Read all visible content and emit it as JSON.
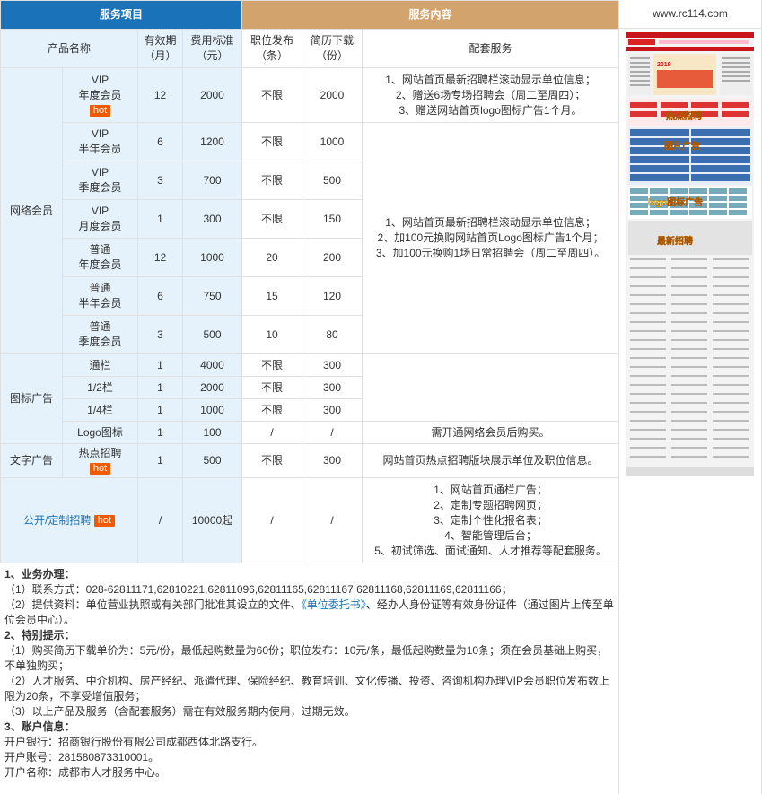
{
  "header": {
    "left": "服务项目",
    "right": "服务内容",
    "site": "www.rc114.com"
  },
  "columns": {
    "product": "产品名称",
    "period": [
      "有效期",
      "（月）"
    ],
    "fee": [
      "费用标准",
      "（元）"
    ],
    "jobs": [
      "职位发布",
      "（条）"
    ],
    "resume": [
      "简历下载",
      "（份）"
    ],
    "service": "配套服务"
  },
  "hot_label": "hot",
  "groups": {
    "network": "网络会员",
    "icon": "图标广告",
    "text": "文字广告",
    "public": "公开/定制招聘"
  },
  "rows": [
    {
      "name": [
        "VIP",
        "年度会员"
      ],
      "months": "12",
      "fee": "2000",
      "jobs": "不限",
      "resumes": "2000"
    },
    {
      "name": [
        "VIP",
        "半年会员"
      ],
      "months": "6",
      "fee": "1200",
      "jobs": "不限",
      "resumes": "1000"
    },
    {
      "name": [
        "VIP",
        "季度会员"
      ],
      "months": "3",
      "fee": "700",
      "jobs": "不限",
      "resumes": "500"
    },
    {
      "name": [
        "VIP",
        "月度会员"
      ],
      "months": "1",
      "fee": "300",
      "jobs": "不限",
      "resumes": "150"
    },
    {
      "name": [
        "普通",
        "年度会员"
      ],
      "months": "12",
      "fee": "1000",
      "jobs": "20",
      "resumes": "200"
    },
    {
      "name": [
        "普通",
        "半年会员"
      ],
      "months": "6",
      "fee": "750",
      "jobs": "15",
      "resumes": "120"
    },
    {
      "name": [
        "普通",
        "季度会员"
      ],
      "months": "3",
      "fee": "500",
      "jobs": "10",
      "resumes": "80"
    },
    {
      "name": [
        "通栏"
      ],
      "months": "1",
      "fee": "4000",
      "jobs": "不限",
      "resumes": "300"
    },
    {
      "name": [
        "1/2栏"
      ],
      "months": "1",
      "fee": "2000",
      "jobs": "不限",
      "resumes": "300"
    },
    {
      "name": [
        "1/4栏"
      ],
      "months": "1",
      "fee": "1000",
      "jobs": "不限",
      "resumes": "300"
    },
    {
      "name": [
        "Logo图标"
      ],
      "months": "1",
      "fee": "100",
      "jobs": "/",
      "resumes": "/"
    },
    {
      "name": [
        "热点招聘"
      ],
      "months": "1",
      "fee": "500",
      "jobs": "不限",
      "resumes": "300"
    },
    {
      "name": [
        ""
      ],
      "months": "/",
      "fee": "10000起",
      "jobs": "/",
      "resumes": "/"
    }
  ],
  "services": {
    "vip_year": [
      "1、网站首页最新招聘栏滚动显示单位信息；",
      "2、赠送6场专场招聘会（周二至周四）；",
      "3、赠送网站首页logo图标广告1个月。"
    ],
    "others": [
      "1、网站首页最新招聘栏滚动显示单位信息；",
      "2、加100元换购网站首页Logo图标广告1个月；",
      "3、加100元换购1场日常招聘会（周二至周四）。"
    ],
    "logo": "需开通网络会员后购买。",
    "hot": "网站首页热点招聘版块展示单位及职位信息。",
    "public": [
      "1、网站首页通栏广告；",
      "2、定制专题招聘网页；",
      "3、定制个性化报名表；",
      "4、智能管理后台；",
      "5、初试筛选、面试通知、人才推荐等配套服务。"
    ]
  },
  "notes": {
    "h1": "1、业务办理：",
    "contact": "（1）联系方式：028-62811171,62810221,62811096,62811165,62811167,62811168,62811169,62811166；",
    "materials_a": "（2）提供资料：单位营业执照或有关部门批准其设立的文件、",
    "materials_link": "《单位委托书》",
    "materials_b": "、经办人身份证等有效身份证件（通过图片上传至单位会员中心）。",
    "h2": "2、特别提示：",
    "tip1": "（1）购买简历下载单价为：5元/份，最低起购数量为60份；职位发布：10元/条，最低起购数量为10条；须在会员基础上购买，不单独购买；",
    "tip2": "（2）人才服务、中介机构、房产经纪、派遣代理、保险经纪、教育培训、文化传播、投资、咨询机构办理VIP会员职位发布数上限为20条，不享受增值服务；",
    "tip3": "（3）以上产品及服务（含配套服务）需在有效服务期内使用，过期无效。",
    "h3": "3、账户信息：",
    "bank": "开户银行：招商银行股份有限公司成都西体北路支行。",
    "account": "开户账号：281580873310001。",
    "holder": "开户名称：成都市人才服务中心。"
  },
  "screenshot": {
    "banner_year": "2019",
    "labels": [
      "热点招聘",
      "图片广告",
      "logo图标广告",
      "最新招聘"
    ]
  }
}
